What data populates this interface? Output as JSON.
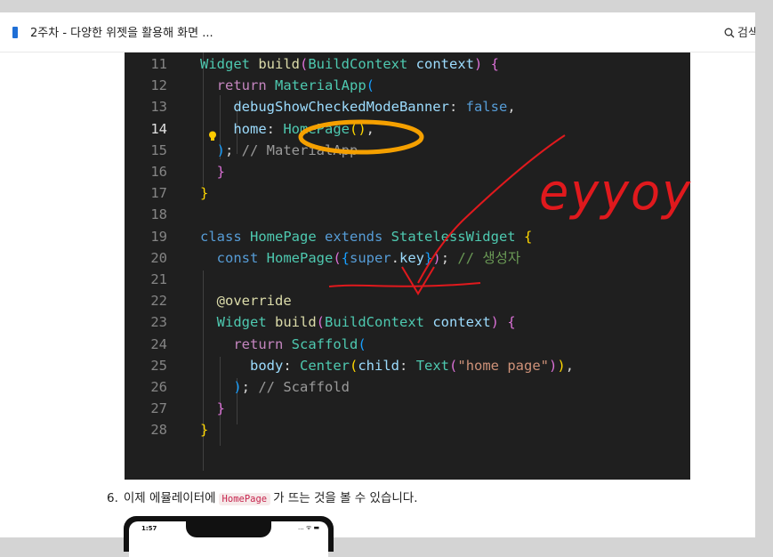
{
  "header": {
    "title": "2주차 - 다양한 위젯을 활용해 화면 ...",
    "search_label": "검색"
  },
  "code": {
    "lines": [
      {
        "num": "11",
        "segments": [
          {
            "t": "Widget ",
            "c": "#4ec9b0"
          },
          {
            "t": "build",
            "c": "#dcdcaa"
          },
          {
            "t": "(",
            "c": "#da70d6"
          },
          {
            "t": "BuildContext ",
            "c": "#4ec9b0"
          },
          {
            "t": "context",
            "c": "#9cdcfe"
          },
          {
            "t": ") {",
            "c": "#da70d6"
          }
        ]
      },
      {
        "num": "12",
        "segments": [
          {
            "t": "  return ",
            "c": "#c586c0"
          },
          {
            "t": "MaterialApp",
            "c": "#4ec9b0"
          },
          {
            "t": "(",
            "c": "#179fff"
          }
        ]
      },
      {
        "num": "13",
        "segments": [
          {
            "t": "    debugShowCheckedModeBanner",
            "c": "#9cdcfe"
          },
          {
            "t": ": ",
            "c": "#d4d4d4"
          },
          {
            "t": "false",
            "c": "#569cd6"
          },
          {
            "t": ",",
            "c": "#d4d4d4"
          }
        ]
      },
      {
        "num": "14",
        "segments": [
          {
            "t": "    home",
            "c": "#9cdcfe"
          },
          {
            "t": ": ",
            "c": "#d4d4d4"
          },
          {
            "t": "HomePage",
            "c": "#4ec9b0"
          },
          {
            "t": "()",
            "c": "#ffd700"
          },
          {
            "t": ",",
            "c": "#d4d4d4"
          }
        ]
      },
      {
        "num": "15",
        "segments": [
          {
            "t": "  )",
            "c": "#179fff"
          },
          {
            "t": "; ",
            "c": "#d4d4d4"
          },
          {
            "t": "// MaterialApp",
            "c": "#9a9a9a"
          }
        ]
      },
      {
        "num": "16",
        "segments": [
          {
            "t": "  }",
            "c": "#da70d6"
          }
        ]
      },
      {
        "num": "17",
        "segments": [
          {
            "t": "}",
            "c": "#ffd700"
          }
        ]
      },
      {
        "num": "18",
        "segments": []
      },
      {
        "num": "19",
        "segments": [
          {
            "t": "class ",
            "c": "#569cd6"
          },
          {
            "t": "HomePage ",
            "c": "#4ec9b0"
          },
          {
            "t": "extends ",
            "c": "#569cd6"
          },
          {
            "t": "StatelessWidget ",
            "c": "#4ec9b0"
          },
          {
            "t": "{",
            "c": "#ffd700"
          }
        ]
      },
      {
        "num": "20",
        "segments": [
          {
            "t": "  const ",
            "c": "#569cd6"
          },
          {
            "t": "HomePage",
            "c": "#4ec9b0"
          },
          {
            "t": "(",
            "c": "#da70d6"
          },
          {
            "t": "{",
            "c": "#179fff"
          },
          {
            "t": "super",
            "c": "#569cd6"
          },
          {
            "t": ".",
            "c": "#d4d4d4"
          },
          {
            "t": "key",
            "c": "#9cdcfe"
          },
          {
            "t": "}",
            "c": "#179fff"
          },
          {
            "t": ")",
            "c": "#da70d6"
          },
          {
            "t": "; ",
            "c": "#d4d4d4"
          },
          {
            "t": "// 생성자",
            "c": "#6a9955"
          }
        ]
      },
      {
        "num": "21",
        "segments": []
      },
      {
        "num": "22",
        "segments": [
          {
            "t": "  @override",
            "c": "#dcdcaa"
          }
        ]
      },
      {
        "num": "23",
        "segments": [
          {
            "t": "  Widget ",
            "c": "#4ec9b0"
          },
          {
            "t": "build",
            "c": "#dcdcaa"
          },
          {
            "t": "(",
            "c": "#da70d6"
          },
          {
            "t": "BuildContext ",
            "c": "#4ec9b0"
          },
          {
            "t": "context",
            "c": "#9cdcfe"
          },
          {
            "t": ") {",
            "c": "#da70d6"
          }
        ]
      },
      {
        "num": "24",
        "segments": [
          {
            "t": "    return ",
            "c": "#c586c0"
          },
          {
            "t": "Scaffold",
            "c": "#4ec9b0"
          },
          {
            "t": "(",
            "c": "#179fff"
          }
        ]
      },
      {
        "num": "25",
        "segments": [
          {
            "t": "      body",
            "c": "#9cdcfe"
          },
          {
            "t": ": ",
            "c": "#d4d4d4"
          },
          {
            "t": "Center",
            "c": "#4ec9b0"
          },
          {
            "t": "(",
            "c": "#ffd700"
          },
          {
            "t": "child",
            "c": "#9cdcfe"
          },
          {
            "t": ": ",
            "c": "#d4d4d4"
          },
          {
            "t": "Text",
            "c": "#4ec9b0"
          },
          {
            "t": "(",
            "c": "#da70d6"
          },
          {
            "t": "\"home page\"",
            "c": "#ce9178"
          },
          {
            "t": ")",
            "c": "#da70d6"
          },
          {
            "t": ")",
            "c": "#ffd700"
          },
          {
            "t": ",",
            "c": "#d4d4d4"
          }
        ]
      },
      {
        "num": "26",
        "segments": [
          {
            "t": "    )",
            "c": "#179fff"
          },
          {
            "t": "; ",
            "c": "#d4d4d4"
          },
          {
            "t": "// Scaffold",
            "c": "#9a9a9a"
          }
        ]
      },
      {
        "num": "27",
        "segments": [
          {
            "t": "  }",
            "c": "#da70d6"
          }
        ]
      },
      {
        "num": "28",
        "segments": [
          {
            "t": "}",
            "c": "#ffd700"
          }
        ]
      }
    ],
    "current_line": "14"
  },
  "annotation": {
    "text": "eyyoy",
    "color": "#e0191d",
    "circle_color": "#f5a000"
  },
  "step": {
    "number": "6.",
    "text_before": "이제 에뮬레이터에",
    "code": "HomePage",
    "text_after": "가 뜨는 것을 볼 수 있습니다."
  },
  "phone": {
    "time": "1:57",
    "status": "... ᯤ ▬"
  }
}
